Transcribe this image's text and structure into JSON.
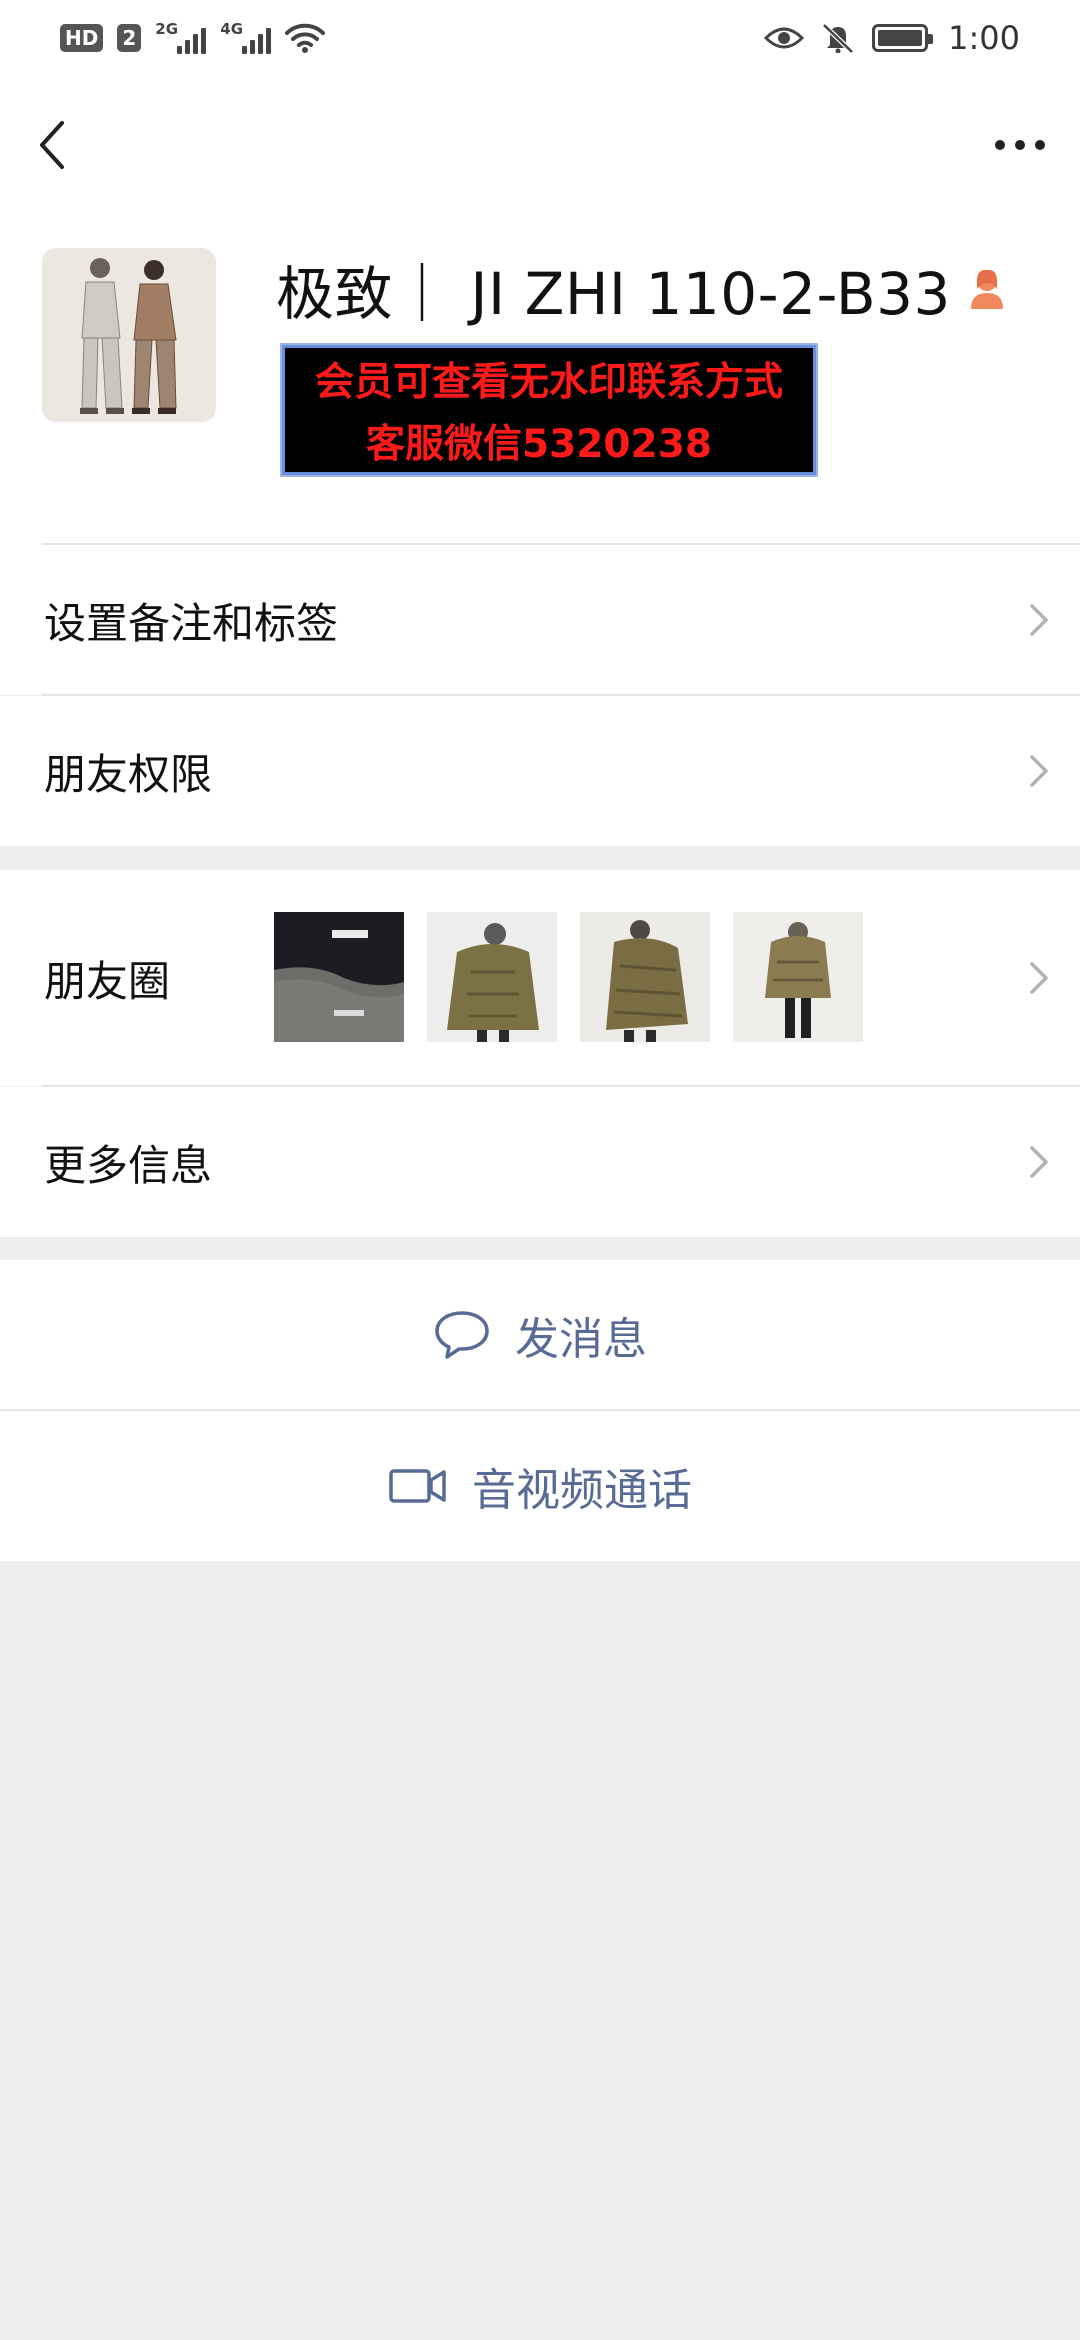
{
  "status_bar": {
    "hd": "HD",
    "sim": "2",
    "net1": "2G",
    "net2": "4G",
    "time": "1:00",
    "battery_level": 1.0
  },
  "nav": {
    "back_icon": "chevron-left-icon",
    "more_icon": "more-dots-icon"
  },
  "profile": {
    "name": "极致｜ JI ZHI  110-2-B33",
    "gender_icon": "user-female-icon",
    "watermark_line1": "会员可查看无水印联系方式",
    "watermark_line2": "客服微信5320238"
  },
  "cells": {
    "remark": "设置备注和标签",
    "permissions": "朋友权限",
    "moments": "朋友圈",
    "more_info": "更多信息"
  },
  "actions": {
    "message": "发消息",
    "call": "音视频通话"
  },
  "colors": {
    "link": "#576b95",
    "watermark_text": "#ff1a1a",
    "bg": "#ededed"
  }
}
